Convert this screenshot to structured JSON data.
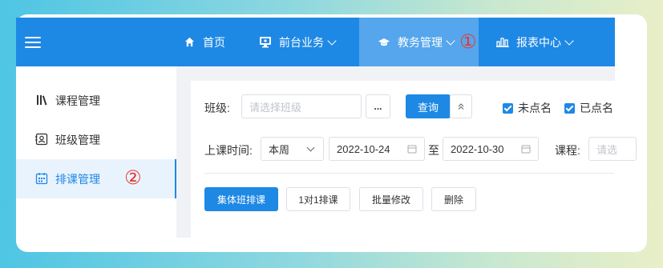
{
  "topnav": {
    "items": [
      {
        "label": "首页",
        "icon": "home-icon"
      },
      {
        "label": "前台业务",
        "icon": "monitor-icon"
      },
      {
        "label": "教务管理",
        "icon": "graduation-cap-icon"
      },
      {
        "label": "报表中心",
        "icon": "bar-chart-icon"
      }
    ],
    "marker": "①"
  },
  "sidebar": {
    "items": [
      {
        "label": "课程管理",
        "icon": "books-icon"
      },
      {
        "label": "班级管理",
        "icon": "profile-card-icon"
      },
      {
        "label": "排课管理",
        "icon": "calendar-icon"
      }
    ],
    "marker": "②"
  },
  "filters": {
    "class_label": "班级:",
    "class_placeholder": "请选择班级",
    "more_label": "...",
    "query_label": "查询",
    "cb_unnamed": "未点名",
    "cb_named": "已点名",
    "time_label": "上课时间:",
    "period": "本周",
    "date_from": "2022-10-24",
    "to_label": "至",
    "date_to": "2022-10-30",
    "course_label": "课程:",
    "course_placeholder": "请选"
  },
  "actions": {
    "group_schedule": "集体班排课",
    "one_on_one": "1对1排课",
    "batch_edit": "批量修改",
    "delete": "删除"
  },
  "colors": {
    "primary": "#1e88e5",
    "marker": "#e53935"
  }
}
